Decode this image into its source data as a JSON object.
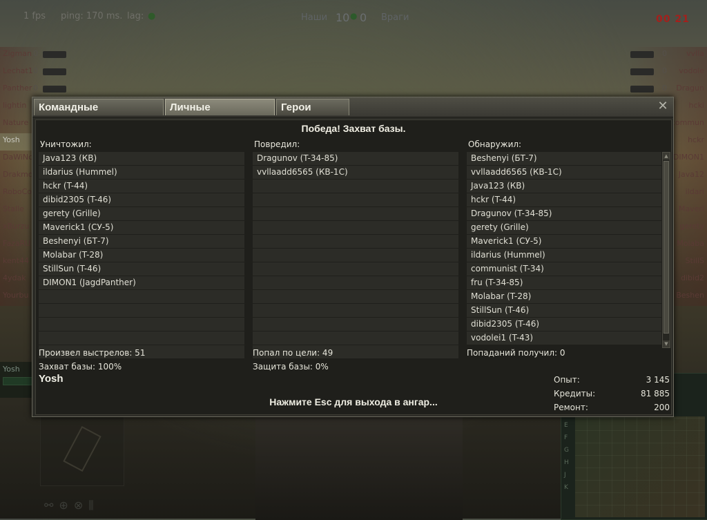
{
  "hud": {
    "fps": "1 fps",
    "ping": "ping: 170 ms.",
    "lag": "lag:",
    "allies_label": "Наши",
    "allies_score": "10",
    "enemies_score": "0",
    "enemies_label": "Враги",
    "timer": "00 21",
    "ally_names": [
      "Zigman",
      "Lechat1",
      "Panther",
      "lightin",
      "Nature",
      "Yosh",
      "DaWiNc",
      "Drakmo",
      "RoboCo",
      "Stalle",
      "xBurzu",
      "FazaRU",
      "kent44",
      "4ydak",
      "Yourbu"
    ],
    "ally_counts": [
      "0",
      "0",
      "0"
    ],
    "enemy_names": [
      "vvlla",
      "vodole",
      "Dragun",
      "hcki",
      "commun",
      "hckr",
      "DIMON1",
      "Java12",
      "ildari",
      "Maveri",
      "gerety",
      "Molaba",
      "StillS",
      "dibid2",
      "Beshen"
    ],
    "enemy_counts": [
      "0",
      "0",
      "0"
    ],
    "self_name": "Yosh",
    "minimap_letters": [
      "E",
      "F",
      "G",
      "H",
      "J",
      "K"
    ],
    "accent_ally": "#5a3a35",
    "timer_color": "#a3201c"
  },
  "dialog": {
    "tabs": [
      {
        "label": "Командные достижения",
        "active": false
      },
      {
        "label": "Личные достижения",
        "active": true
      },
      {
        "label": "Герои битвы",
        "active": false
      }
    ],
    "close_icon": "close-icon",
    "result": "Победа! Захват базы.",
    "destroyed": {
      "title": "Уничтожил:",
      "rows": [
        "Java123 (КВ)",
        "ildarius (Hummel)",
        "hckr (T-44)",
        "dibid2305 (T-46)",
        "gerety (Grille)",
        "Maverick1 (СУ-5)",
        "Beshenyi (БТ-7)",
        "Molabar (T-28)",
        "StillSun (T-46)",
        "DIMON1 (JagdPanther)",
        "",
        "",
        "",
        "",
        ""
      ]
    },
    "damaged": {
      "title": "Повредил:",
      "rows": [
        "Dragunov (T-34-85)",
        "vvllaadd6565 (КВ-1С)",
        "",
        "",
        "",
        "",
        "",
        "",
        "",
        "",
        "",
        "",
        "",
        "",
        ""
      ]
    },
    "spotted": {
      "title": "Обнаружил:",
      "rows": [
        "Beshenyi (БТ-7)",
        "vvllaadd6565 (КВ-1С)",
        "Java123 (КВ)",
        "hckr (T-44)",
        "Dragunov (T-34-85)",
        "gerety (Grille)",
        "Maverick1 (СУ-5)",
        "ildarius (Hummel)",
        "communist (T-34)",
        "fru (T-34-85)",
        "Molabar (T-28)",
        "StillSun (T-46)",
        "dibid2305 (T-46)",
        "vodolei1 (T-43)"
      ]
    },
    "stats": {
      "shots": "Произвел выстрелов: 51",
      "capture": "Захват базы: 100%",
      "hits": "Попал по цели: 49",
      "defense": "Защита базы: 0%",
      "received": "Попаданий получил: 0"
    },
    "player": "Yosh",
    "esc_message": "Нажмите Esc для выхода в ангар...",
    "rewards": [
      {
        "label": "Опыт:",
        "value": "3 145"
      },
      {
        "label": "Кредиты:",
        "value": "81 885"
      },
      {
        "label": "Ремонт:",
        "value": "200"
      }
    ]
  }
}
